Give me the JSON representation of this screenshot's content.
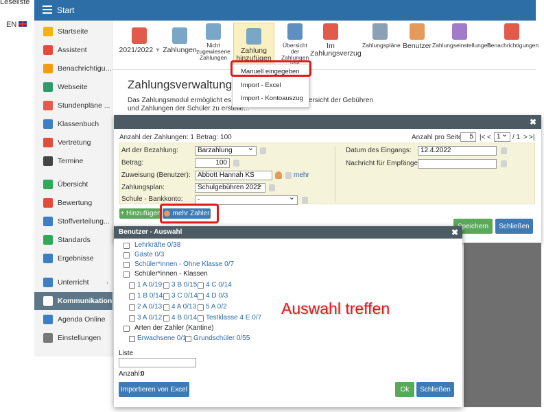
{
  "topleft": {
    "leseliste": "Leseliste",
    "lang": "EN"
  },
  "header": {
    "title": "Start"
  },
  "sidebar": {
    "items": [
      {
        "label": "Startseite",
        "icon": "star-icon",
        "color": "#f5b400"
      },
      {
        "label": "Assistent",
        "icon": "wand-icon",
        "color": "#e54b3c"
      },
      {
        "label": "Benachrichtigu...",
        "icon": "envelope-icon",
        "color": "#f39c12"
      },
      {
        "label": "Webseite",
        "icon": "house-icon",
        "color": "#2e9b6b"
      },
      {
        "label": "Stundenpläne ...",
        "icon": "calendar-icon",
        "color": "#e25b4a"
      },
      {
        "label": "Klassenbuch",
        "icon": "book-icon",
        "color": "#3c7fc5"
      },
      {
        "label": "Vertretung",
        "icon": "person-icon",
        "color": "#e54b3c"
      },
      {
        "label": "Termine",
        "icon": "calendar-dark-icon",
        "color": "#444444"
      },
      {
        "label": "Übersicht",
        "icon": "check-circle-icon",
        "color": "#2eaa5a"
      },
      {
        "label": "Bewertung",
        "icon": "grade-icon",
        "color": "#e54b3c"
      },
      {
        "label": "Stoffverteilung...",
        "icon": "briefcase-icon",
        "color": "#3c7fc5"
      },
      {
        "label": "Standards",
        "icon": "shield-icon",
        "color": "#2eaa5a"
      },
      {
        "label": "Ergebnisse",
        "icon": "bar-chart-icon",
        "color": "#3c7fc5"
      },
      {
        "label": "Unterricht",
        "icon": "classroom-icon",
        "color": "#3c7fc5"
      },
      {
        "label": "Kommunikation",
        "icon": "chat-icon",
        "color": "#ffffff"
      },
      {
        "label": "Agenda Online",
        "icon": "pen-icon",
        "color": "#3c7fc5"
      },
      {
        "label": "Einstellungen",
        "icon": "gear-icon",
        "color": "#777777"
      }
    ]
  },
  "toolbar": {
    "items": [
      {
        "label": "2021/2022",
        "icon": "calendar-icon",
        "color": "#e25b4a"
      },
      {
        "label": "Zahlungen",
        "icon": "money-bag-icon",
        "color": "#7aa6c8"
      },
      {
        "label": "Nicht zugewiesene Zahlungen",
        "icon": "money-bag-question-icon",
        "color": "#7aa6c8"
      },
      {
        "label": "Zahlung hinzufügen",
        "icon": "money-bag-add-icon",
        "color": "#7aa6c8"
      },
      {
        "label": "Übersicht der Zahlungen von Benutzern",
        "icon": "euro-book-icon",
        "color": "#5d8fc1"
      },
      {
        "label": "Im Zahlungsverzug",
        "icon": "money-bag-overdue-icon",
        "color": "#e25b4a"
      },
      {
        "label": "Zahlungspläne",
        "icon": "schedule-icon",
        "color": "#8aa0b4"
      },
      {
        "label": "Benutzer",
        "icon": "user-icon",
        "color": "#e59a5a"
      },
      {
        "label": "Zahlungseinstellungen",
        "icon": "gear-icon",
        "color": "#a27bc8"
      },
      {
        "label": "Benachrichtigungen",
        "icon": "phone-icon",
        "color": "#e25b4a"
      }
    ]
  },
  "dropdown": {
    "items": [
      "Manuell eingegeben",
      "Import - Excel",
      "Import - Kontoauszug"
    ]
  },
  "page": {
    "title": "Zahlungsverwaltung",
    "intro_line1": "Das Zahlungsmodul ermöglicht es Sc",
    "intro_line2": "und Zahlungen der Schüler zu erstelle...",
    "intro_right": "ersicht der Gebühren"
  },
  "payment_dialog": {
    "count_label": "Anzahl der Zahlungen: 1",
    "amount_label": "Betrag: 100",
    "per_page_label": "Anzahl pro Seite:",
    "per_page_value": "5",
    "pager_first": "|<",
    "pager_prev": "<",
    "page_value": "1",
    "page_total": "/ 1",
    "pager_next": ">",
    "pager_last": ">|",
    "fields": {
      "type_label": "Art der Bezahlung:",
      "type_value": "Barzahlung",
      "amount_label": "Betrag:",
      "amount_value": "100",
      "user_label": "Zuweisung (Benutzer):",
      "user_value": "Abbott Hannah KS",
      "more_link": "mehr",
      "plan_label": "Zahlungsplan:",
      "plan_value": "Schulgebühren 2022",
      "bank_label": "Schule - Bankkonto:",
      "bank_value": "-",
      "date_label": "Datum des Eingangs:",
      "date_value": "12.4.2022",
      "message_label": "Nachricht für Empfänger:",
      "message_value": ""
    },
    "add_button": "+ Hinzufügen",
    "more_payers_button": "mehr Zahler",
    "save_button": "Speichern",
    "close_button": "Schließen"
  },
  "user_dialog": {
    "title": "Benutzer - Auswahl",
    "groups": [
      {
        "label": "Lehrkräfte 0/38",
        "link": true
      },
      {
        "label": "Gäste 0/3",
        "link": true
      },
      {
        "label": "Schüler*innen - Ohne Klasse 0/7",
        "link": true
      },
      {
        "label": "Schüler*innen - Klassen",
        "link": false
      }
    ],
    "classes": [
      [
        "1 A 0/19",
        "3 B 0/15",
        "4 C 0/14"
      ],
      [
        "1 B 0/14",
        "3 C 0/14",
        "4 D 0/3"
      ],
      [
        "2 A 0/13",
        "4 A 0/13",
        "5 A 0/2"
      ],
      [
        "3 A 0/12",
        "4 B 0/14",
        "Testklasse 4 E 0/7"
      ]
    ],
    "payer_types_label": "Arten der Zahler (Kantine)",
    "payer_types": [
      "Erwachsene 0/1",
      "Grundschüler 0/55"
    ],
    "list_label": "Liste",
    "list_value": "",
    "count_label": "Anzahl:",
    "count_value": "0",
    "import_button": "Importieren von Excel",
    "ok_button": "Ok",
    "close_button": "Schließen"
  },
  "annotation": "Auswahl treffen"
}
